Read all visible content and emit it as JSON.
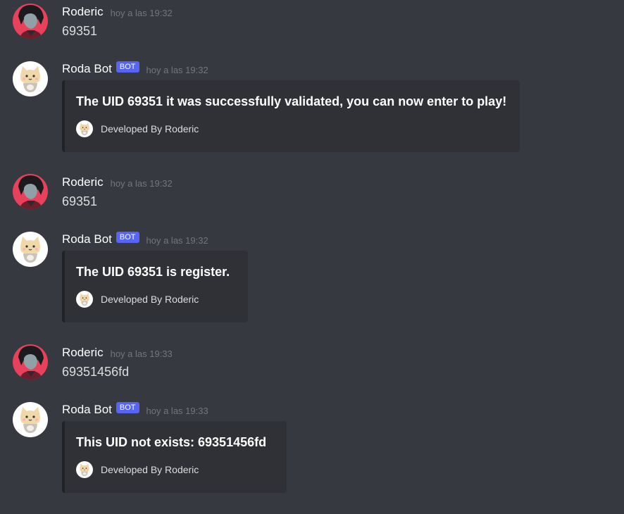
{
  "colors": {
    "background": "#36393f",
    "embed_background": "#2f3136",
    "bot_tag": "#5865f2",
    "timestamp": "#72767d"
  },
  "messages": [
    {
      "username": "Roderic",
      "avatar_icon": "roderic-avatar-icon",
      "timestamp": "hoy a las 19:32",
      "content": "69351"
    },
    {
      "username": "Roda Bot",
      "bot_tag": "BOT",
      "avatar_icon": "cat-bot-avatar-icon",
      "timestamp": "hoy a las 19:32",
      "embed": {
        "description": "The UID 69351 it was successfully validated, you can now enter to play!",
        "footer": "Developed By Roderic"
      }
    },
    {
      "username": "Roderic",
      "avatar_icon": "roderic-avatar-icon",
      "timestamp": "hoy a las 19:32",
      "content": "69351"
    },
    {
      "username": "Roda Bot",
      "bot_tag": "BOT",
      "avatar_icon": "cat-bot-avatar-icon",
      "timestamp": "hoy a las 19:32",
      "embed": {
        "description": "The UID 69351 is register.",
        "footer": "Developed By Roderic"
      }
    },
    {
      "username": "Roderic",
      "avatar_icon": "roderic-avatar-icon",
      "timestamp": "hoy a las 19:33",
      "content": "69351456fd"
    },
    {
      "username": "Roda Bot",
      "bot_tag": "BOT",
      "avatar_icon": "cat-bot-avatar-icon",
      "timestamp": "hoy a las 19:33",
      "embed": {
        "description": "This UID not exists: 69351456fd",
        "footer": "Developed By Roderic"
      }
    }
  ]
}
